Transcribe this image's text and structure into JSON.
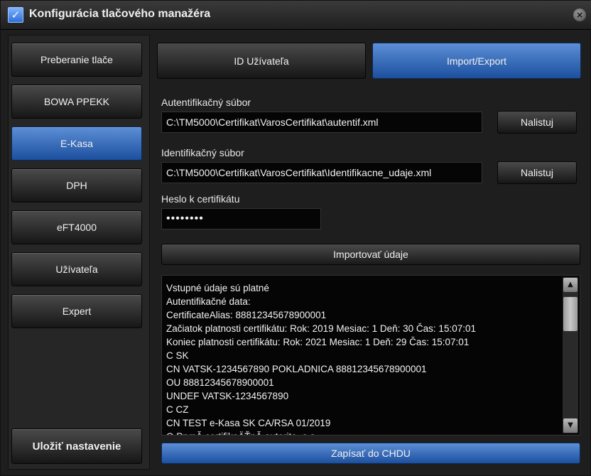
{
  "window": {
    "title": "Konfigurácia tlačového manažéra",
    "check_glyph": "✓",
    "close_glyph": "×"
  },
  "sidebar": {
    "items": [
      {
        "label": "Preberanie tlače"
      },
      {
        "label": "BOWA PPEKK"
      },
      {
        "label": "E-Kasa",
        "active": true
      },
      {
        "label": "DPH"
      },
      {
        "label": "eFT4000"
      },
      {
        "label": "Užívateľa"
      },
      {
        "label": "Expert"
      }
    ],
    "save_label": "Uložiť nastavenie"
  },
  "tabs": [
    {
      "label": "ID Užívateľa"
    },
    {
      "label": "Import/Export",
      "active": true
    }
  ],
  "form": {
    "auth_label": "Autentifikačný súbor",
    "auth_value": "C:\\TM5000\\Certifikat\\VarosCertifikat\\autentif.xml",
    "ident_label": "Identifikačný súbor",
    "ident_value": "C:\\TM5000\\Certifikat\\VarosCertifikat\\Identifikacne_udaje.xml",
    "browse_label": "Nalistuj",
    "password_label": "Heslo k certifikátu",
    "password_value": "••••••••",
    "import_label": "Importovať údaje",
    "write_label": "Zapísať do CHDU"
  },
  "log": {
    "lines": [
      "Vstupné údaje sú platné",
      "Autentifikačné data:",
      "CertificateAlias: 88812345678900001",
      "Začiatok platnosti certifikátu: Rok: 2019 Mesiac: 1 Deň: 30 Čas: 15:07:01",
      "Koniec platnosti certifikátu: Rok: 2021 Mesiac: 1 Deň: 29 Čas: 15:07:01",
      "C SK",
      "CN VATSK-1234567890 POKLADNICA 88812345678900001",
      "OU 88812345678900001",
      "UNDEF VATSK-1234567890",
      "C CZ",
      "CN TEST e-Kasa SK CA/RSA 01/2019",
      "O PrvnĂ­ certifikaÄŤnĂ­ autorita, a.s."
    ],
    "scroll_up_glyph": "▲",
    "scroll_down_glyph": "▼"
  },
  "colors": {
    "accent_blue": "#2f6fd8",
    "background": "#1e1e1e",
    "field_bg": "#050505"
  }
}
